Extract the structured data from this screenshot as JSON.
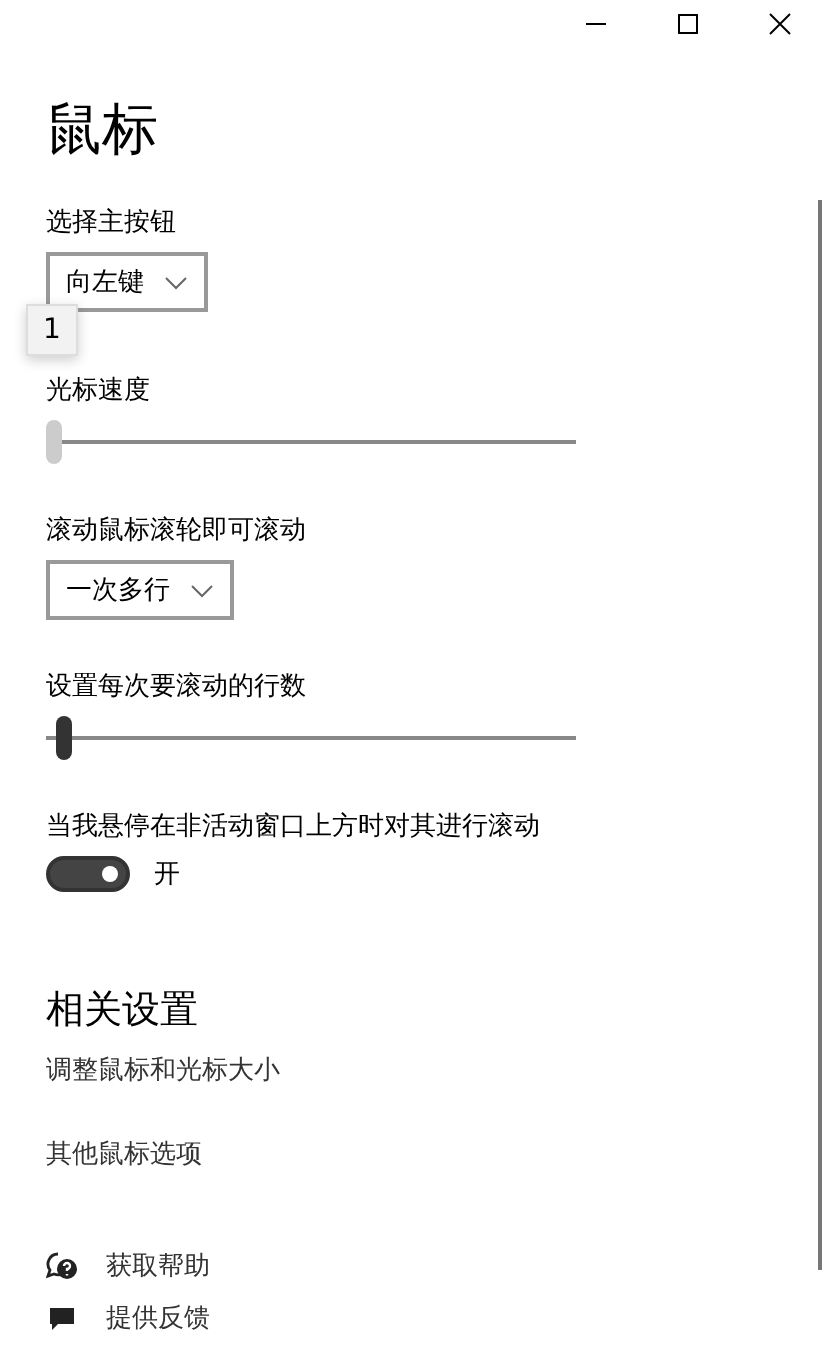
{
  "window": {
    "title": "鼠标"
  },
  "settings": [
    {
      "kind": "dropdown",
      "label": "选择主按钮",
      "value": "向左键"
    },
    {
      "kind": "slider",
      "label": "光标速度",
      "level": 0.0,
      "tooltip": "1",
      "hover": true
    },
    {
      "kind": "dropdown",
      "label": "滚动鼠标滚轮即可滚动",
      "value": "一次多行"
    },
    {
      "kind": "slider",
      "label": "设置每次要滚动的行数",
      "level": 0.02,
      "hover": false
    },
    {
      "kind": "toggle",
      "label": "当我悬停在非活动窗口上方时对其进行滚动",
      "on": true,
      "state_text": "开"
    }
  ],
  "related": {
    "heading": "相关设置",
    "links": [
      "调整鼠标和光标大小",
      "其他鼠标选项"
    ]
  },
  "help": [
    {
      "kind": "help",
      "label": "获取帮助"
    },
    {
      "kind": "feedback",
      "label": "提供反馈"
    }
  ]
}
